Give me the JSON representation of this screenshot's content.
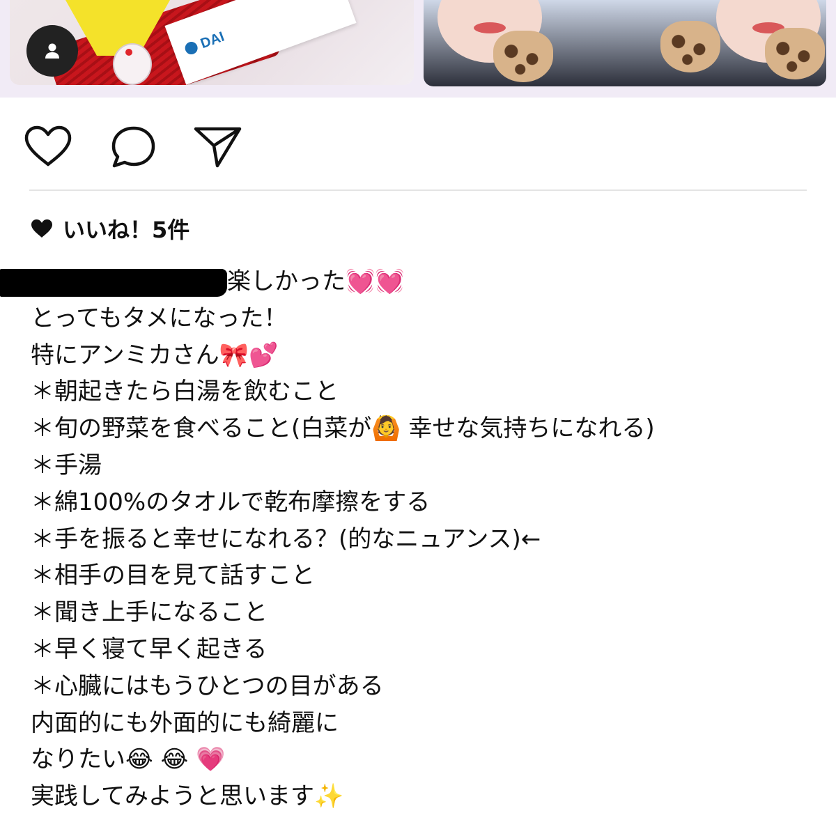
{
  "post": {
    "images": [
      {
        "alt": "photo-left",
        "accent": "#c8161d",
        "logo_text": "DAI"
      },
      {
        "alt": "photo-right",
        "accent": "#d8b38a"
      }
    ]
  },
  "actions": {
    "like_icon": "heart-outline-icon",
    "comment_icon": "comment-bubble-icon",
    "share_icon": "paper-plane-icon",
    "tag_icon": "person-icon"
  },
  "likes": {
    "icon": "heart-filled-icon",
    "text": "いいね！5件"
  },
  "caption": {
    "username": "[redacted]",
    "lines": [
      "楽しかった💓💓",
      "とってもタメになった！",
      "特にアンミカさん🎀💕",
      "＊朝起きたら白湯を飲むこと",
      "＊旬の野菜を食べること(白菜が🙆 幸せな気持ちになれる)",
      "＊手湯",
      "＊綿100%のタオルで乾布摩擦をする",
      "＊手を振ると幸せになれる？(的なニュアンス)←",
      "＊相手の目を見て話すこと",
      "＊聞き上手になること",
      "＊早く寝て早く起きる",
      "＊心臓にはもうひとつの目がある",
      "内面的にも外面的にも綺麗に",
      "なりたい😂 😂 💗",
      "実践してみようと思います✨"
    ]
  },
  "colors": {
    "text": "#111111",
    "divider": "#e4e4e4",
    "strip_background": "#f1ebf6",
    "badge": "#222222"
  }
}
